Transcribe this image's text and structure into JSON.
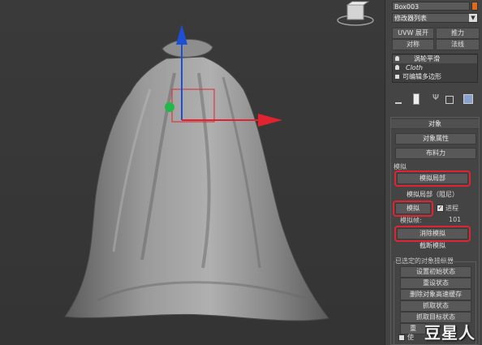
{
  "object_name": "Box003",
  "modifier_list": "修改器列表",
  "buttons_top": [
    "UVW 展开",
    "推力",
    "对称",
    "法线"
  ],
  "stack": [
    "涡轮平滑",
    "Cloth",
    "可编辑多边形"
  ],
  "rollout_title": "对象",
  "btn_object_props": "对象属性",
  "btn_cloth_force": "布料力",
  "section_sim": "模拟",
  "btn_sim_local": "模拟局部",
  "btn_sim_local_damp": "模拟局部（阻尼）",
  "btn_simulate": "模拟",
  "lbl_progress": "进程",
  "lbl_sim_frame": "模拟帧:",
  "sim_frame_value": "101",
  "btn_clear_sim": "消除模拟",
  "btn_truncate_sim": "截断模拟",
  "section_selected": "已选定的对象操纵器",
  "btn_set_initial": "设置初始状态",
  "btn_reset": "重设状态",
  "btn_delete_cache": "删除对象高速缓存",
  "btn_grab_state": "抓取状态",
  "btn_grab_target": "抓取目标状态",
  "btn_partial_1": "重",
  "lbl_partial_bottom": "使",
  "watermark": "豆星人",
  "colors": {
    "highlight": "#e0242f",
    "panel_bg": "#444444",
    "viewport_bg": "#383838",
    "gizmo_x": "#e0242f",
    "gizmo_y": "#22b84a",
    "gizmo_z": "#1c4fd6"
  }
}
